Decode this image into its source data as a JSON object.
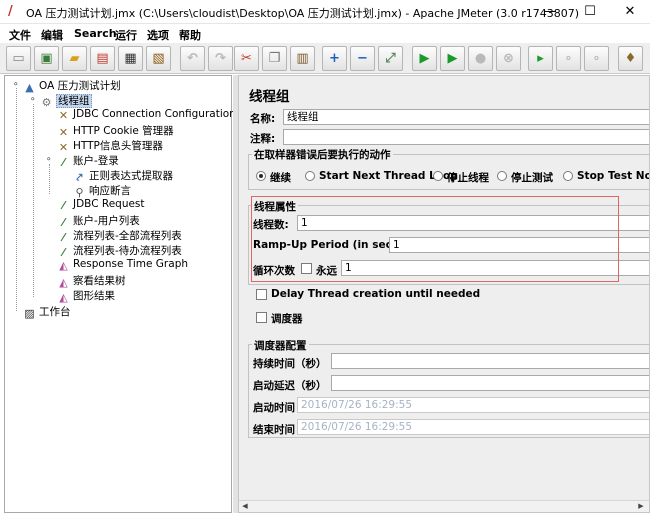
{
  "window": {
    "title": "OA 压力测试计划.jmx (C:\\Users\\cloudist\\Desktop\\OA 压力测试计划.jmx) - Apache JMeter (3.0 r1743807)",
    "minimize_glyph": "—",
    "maximize_glyph": "☐",
    "close_glyph": "✕"
  },
  "menu": [
    "文件",
    "编辑",
    "Search",
    "运行",
    "选项",
    "帮助"
  ],
  "toolbar": {
    "icons": [
      "new-icon",
      "templates-icon",
      "open-icon",
      "close-file-icon",
      "save-icon",
      "save-as-icon",
      "undo-icon",
      "redo-icon",
      "cut-icon",
      "copy-icon",
      "paste-icon",
      "expand-icon",
      "collapse-icon",
      "toggle-icon",
      "start-icon",
      "start-no-pause-icon",
      "stop-icon",
      "shutdown-icon",
      "remote-start-icon",
      "remote-stop-icon",
      "remote-shutdown-icon",
      "clear-icon"
    ]
  },
  "tree": [
    {
      "label": "OA 压力测试计划",
      "icon": "test-plan-icon"
    },
    {
      "label": "线程组",
      "icon": "thread-group-icon"
    },
    {
      "label": "JDBC Connection Configuration",
      "icon": "config-icon"
    },
    {
      "label": "HTTP Cookie 管理器",
      "icon": "config-icon"
    },
    {
      "label": "HTTP信息头管理器",
      "icon": "config-icon"
    },
    {
      "label": "账户-登录",
      "icon": "sampler-icon"
    },
    {
      "label": "正则表达式提取器",
      "icon": "extractor-icon"
    },
    {
      "label": "响应断言",
      "icon": "assertion-icon"
    },
    {
      "label": "JDBC Request",
      "icon": "sampler-icon"
    },
    {
      "label": "账户-用户列表",
      "icon": "sampler-icon"
    },
    {
      "label": "流程列表-全部流程列表",
      "icon": "sampler-icon"
    },
    {
      "label": "流程列表-待办流程列表",
      "icon": "sampler-icon"
    },
    {
      "label": "Response Time Graph",
      "icon": "listener-icon"
    },
    {
      "label": "察看结果树",
      "icon": "listener-icon"
    },
    {
      "label": "图形结果",
      "icon": "listener-icon"
    },
    {
      "label": "工作台",
      "icon": "workbench-icon"
    }
  ],
  "panel": {
    "title": "线程组",
    "name_label": "名称:",
    "name_value": "线程组",
    "comment_label": "注释:",
    "comment_value": "",
    "error_action_legend": "在取样器错误后要执行的动作",
    "error_actions": [
      {
        "label": "继续",
        "selected": true
      },
      {
        "label": "Start Next Thread Loop",
        "selected": false
      },
      {
        "label": "停止线程",
        "selected": false
      },
      {
        "label": "停止测试",
        "selected": false
      },
      {
        "label": "Stop Test Now",
        "selected": false
      }
    ],
    "thread_props_legend": "线程属性",
    "threads_label": "线程数:",
    "threads_value": "1",
    "rampup_label": "Ramp-Up Period (in seconds):",
    "rampup_value": "1",
    "loop_label": "循环次数",
    "forever_label": "永远",
    "forever_checked": false,
    "loop_value": "1",
    "delay_label": "Delay Thread creation until needed",
    "delay_checked": false,
    "scheduler_label": "调度器",
    "scheduler_checked": false,
    "scheduler_legend": "调度器配置",
    "duration_label": "持续时间（秒）",
    "duration_value": "",
    "startup_delay_label": "启动延迟（秒）",
    "startup_delay_value": "",
    "start_time_label": "启动时间",
    "start_time_value": "2016/07/26 16:29:55",
    "end_time_label": "结束时间",
    "end_time_value": "2016/07/26 16:29:55"
  },
  "colors": {
    "highlight_box": "#e06666",
    "selection": "#c4d7ee",
    "panel_bg": "#eeeeee"
  }
}
